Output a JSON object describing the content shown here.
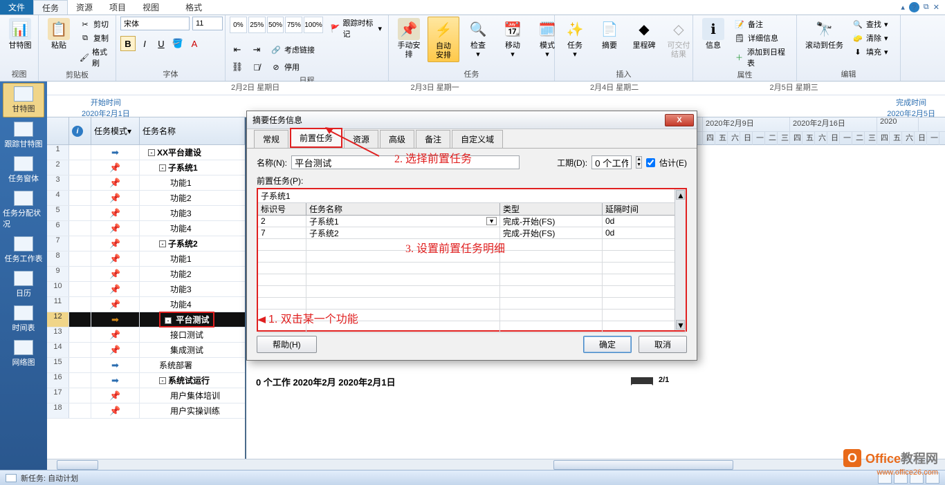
{
  "menu": {
    "file": "文件",
    "task": "任务",
    "resource": "资源",
    "project": "项目",
    "view": "视图",
    "format": "格式"
  },
  "ribbon": {
    "view_group": "视图",
    "gantt": "甘特图",
    "clipboard_group": "剪贴板",
    "paste": "粘贴",
    "cut": "剪切",
    "copy": "复制",
    "formatpaint": "格式刷",
    "font_group": "字体",
    "font_name": "宋体",
    "font_size": "11",
    "schedule_group": "日程",
    "track_label": "跟踪时标记",
    "link": "考虑链接",
    "disable": "停用",
    "manual": "手动安排",
    "auto": "自动安排",
    "tasks_group": "任务",
    "inspect": "检查",
    "move": "移动",
    "mode": "模式",
    "insert_group": "插入",
    "task_btn": "任务",
    "summary": "摘要",
    "milestone": "里程碑",
    "deliverable": "可交付结果",
    "info": "信息",
    "props_group": "属性",
    "notes": "备注",
    "details": "详细信息",
    "addtl": "添加到日程表",
    "scrollto": "滚动到任务",
    "edit_group": "编辑",
    "find": "查找",
    "clear": "清除",
    "fill": "填充"
  },
  "timeline": {
    "d1": "2月2日 星期日",
    "d2": "2月3日 星期一",
    "d3": "2月4日 星期二",
    "d4": "2月5日 星期三",
    "start_lbl": "开始时间",
    "start_date": "2020年2月1日",
    "end_lbl": "完成时间",
    "end_date": "2020年2月5日"
  },
  "side": {
    "gantt": "甘特图",
    "track": "跟踪甘特图",
    "taskwin": "任务窗体",
    "assign": "任务分配状况",
    "sheet": "任务工作表",
    "cal": "日历",
    "timeline": "时间表",
    "network": "网络图"
  },
  "grid": {
    "col_mode": "任务模式",
    "col_name": "任务名称",
    "rows": [
      {
        "n": "1",
        "name": "XX平台建设",
        "lvl": 0,
        "exp": true,
        "mode": "a"
      },
      {
        "n": "2",
        "name": "子系统1",
        "lvl": 1,
        "exp": true,
        "mode": "p"
      },
      {
        "n": "3",
        "name": "功能1",
        "lvl": 2,
        "mode": "p"
      },
      {
        "n": "4",
        "name": "功能2",
        "lvl": 2,
        "mode": "p"
      },
      {
        "n": "5",
        "name": "功能3",
        "lvl": 2,
        "mode": "p"
      },
      {
        "n": "6",
        "name": "功能4",
        "lvl": 2,
        "mode": "p"
      },
      {
        "n": "7",
        "name": "子系统2",
        "lvl": 1,
        "exp": true,
        "mode": "p"
      },
      {
        "n": "8",
        "name": "功能1",
        "lvl": 2,
        "mode": "p"
      },
      {
        "n": "9",
        "name": "功能2",
        "lvl": 2,
        "mode": "p"
      },
      {
        "n": "10",
        "name": "功能3",
        "lvl": 2,
        "mode": "p"
      },
      {
        "n": "11",
        "name": "功能4",
        "lvl": 2,
        "mode": "p"
      },
      {
        "n": "12",
        "name": "平台测试",
        "lvl": 1,
        "exp": true,
        "mode": "ay",
        "sel": true
      },
      {
        "n": "13",
        "name": "接口测试",
        "lvl": 2,
        "mode": "p"
      },
      {
        "n": "14",
        "name": "集成测试",
        "lvl": 2,
        "mode": "p"
      },
      {
        "n": "15",
        "name": "系统部署",
        "lvl": 1,
        "mode": "a"
      },
      {
        "n": "16",
        "name": "系统试运行",
        "lvl": 1,
        "exp": true,
        "mode": "a",
        "extra": "0 个工作 2020年2月 2020年2月1日"
      },
      {
        "n": "17",
        "name": "用户集体培训",
        "lvl": 2,
        "mode": "p"
      },
      {
        "n": "18",
        "name": "用户实操训练",
        "lvl": 2,
        "mode": "p"
      }
    ]
  },
  "gantt_head": {
    "w1": "2020年2月9日",
    "w2": "2020年2月16日",
    "w3": "2020",
    "days": "四|五|六|日|一|二|三|四|五|六|日|一|二|三|四|五|六|日|一"
  },
  "gantt_bar_label": "2/1",
  "dialog": {
    "title": "摘要任务信息",
    "tabs": {
      "general": "常规",
      "pred": "前置任务",
      "res": "资源",
      "adv": "高级",
      "notes": "备注",
      "custom": "自定义域"
    },
    "name_lbl": "名称(N):",
    "name_val": "平台测试",
    "dur_lbl": "工期(D):",
    "dur_val": "0 个工作",
    "est_lbl": "估计(E)",
    "pred_lbl": "前置任务(P):",
    "hint": "子系统1",
    "cols": {
      "id": "标识号",
      "name": "任务名称",
      "type": "类型",
      "lag": "延隔时间"
    },
    "rows": [
      {
        "id": "2",
        "name": "子系统1",
        "type": "完成-开始(FS)",
        "lag": "0d"
      },
      {
        "id": "7",
        "name": "子系统2",
        "type": "完成-开始(FS)",
        "lag": "0d"
      }
    ],
    "help": "帮助(H)",
    "ok": "确定",
    "cancel": "取消"
  },
  "ann": {
    "a1": "1. 双击某一个功能",
    "a2": "2. 选择前置任务",
    "a3": "3. 设置前置任务明细"
  },
  "status": {
    "text": "新任务: 自动计划"
  },
  "wm": {
    "t1": "Office",
    "t2": "教程网",
    "url": "www.office26.com"
  }
}
